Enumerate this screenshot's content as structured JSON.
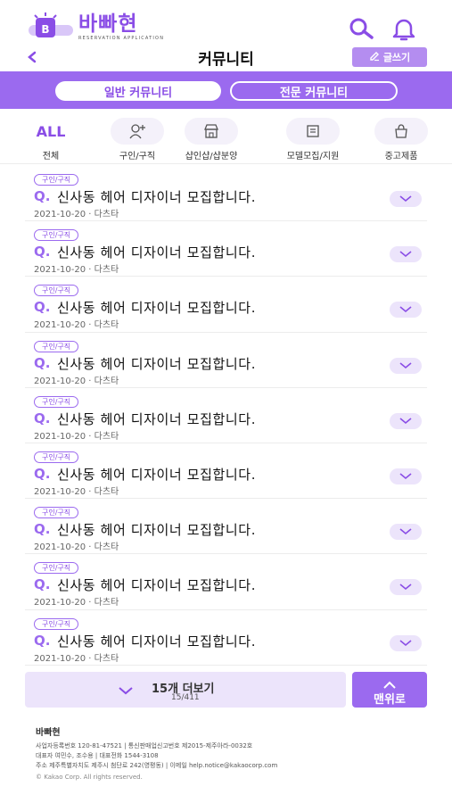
{
  "header": {
    "logo_text": "바빠현",
    "logo_sub": "RESERVATION APPLICATION",
    "title": "커뮤니티",
    "write_label": "글쓰기"
  },
  "tabs": {
    "general": "일반 커뮤니티",
    "expert": "전문 커뮤니티"
  },
  "categories": [
    {
      "label": "전체",
      "icon": "all"
    },
    {
      "label": "구인/구직",
      "icon": "person-add-icon"
    },
    {
      "label": "샵인샵/샵분양",
      "icon": "shop-icon"
    },
    {
      "label": "모델모집/지원",
      "icon": "document-icon"
    },
    {
      "label": "중고제품",
      "icon": "bag-icon"
    }
  ],
  "categories_all_text": "ALL",
  "posts": [
    {
      "tag": "구인/구직",
      "q": "Q.",
      "title": "신사동 헤어 디자이너 모집합니다.",
      "meta": "2021-10-20 · 다츠타"
    },
    {
      "tag": "구인/구직",
      "q": "Q.",
      "title": "신사동 헤어 디자이너 모집합니다.",
      "meta": "2021-10-20 · 다츠타"
    },
    {
      "tag": "구인/구직",
      "q": "Q.",
      "title": "신사동 헤어 디자이너 모집합니다.",
      "meta": "2021-10-20 · 다츠타"
    },
    {
      "tag": "구인/구직",
      "q": "Q.",
      "title": "신사동 헤어 디자이너 모집합니다.",
      "meta": "2021-10-20 · 다츠타"
    },
    {
      "tag": "구인/구직",
      "q": "Q.",
      "title": "신사동 헤어 디자이너 모집합니다.",
      "meta": "2021-10-20 · 다츠타"
    },
    {
      "tag": "구인/구직",
      "q": "Q.",
      "title": "신사동 헤어 디자이너 모집합니다.",
      "meta": "2021-10-20 · 다츠타"
    },
    {
      "tag": "구인/구직",
      "q": "Q.",
      "title": "신사동 헤어 디자이너 모집합니다.",
      "meta": "2021-10-20 · 다츠타"
    },
    {
      "tag": "구인/구직",
      "q": "Q.",
      "title": "신사동 헤어 디자이너 모집합니다.",
      "meta": "2021-10-20 · 다츠타"
    },
    {
      "tag": "구인/구직",
      "q": "Q.",
      "title": "신사동 헤어 디자이너 모집합니다.",
      "meta": "2021-10-20 · 다츠타"
    }
  ],
  "more": {
    "label": "15개 더보기",
    "count": "15/411"
  },
  "to_top": "맨위로",
  "footer": {
    "brand": "바빠현",
    "line1": "사업자등록번호 120-81-47521  |  통신판매업신고번호 제2015-제주아라-0032호",
    "line2": "대표자 여민수, 조수용  |  대표전화 1544-3108",
    "line3": "주소 제주특별자치도 제주시 첨단로 242(영평동)  |  이메일 help.notice@kakaocorp.com",
    "copyright": "© Kakao Corp. All rights reserved."
  },
  "colors": {
    "accent": "#9b6aef",
    "accent_dark": "#8a4de6",
    "accent_light": "#ece4fb"
  }
}
